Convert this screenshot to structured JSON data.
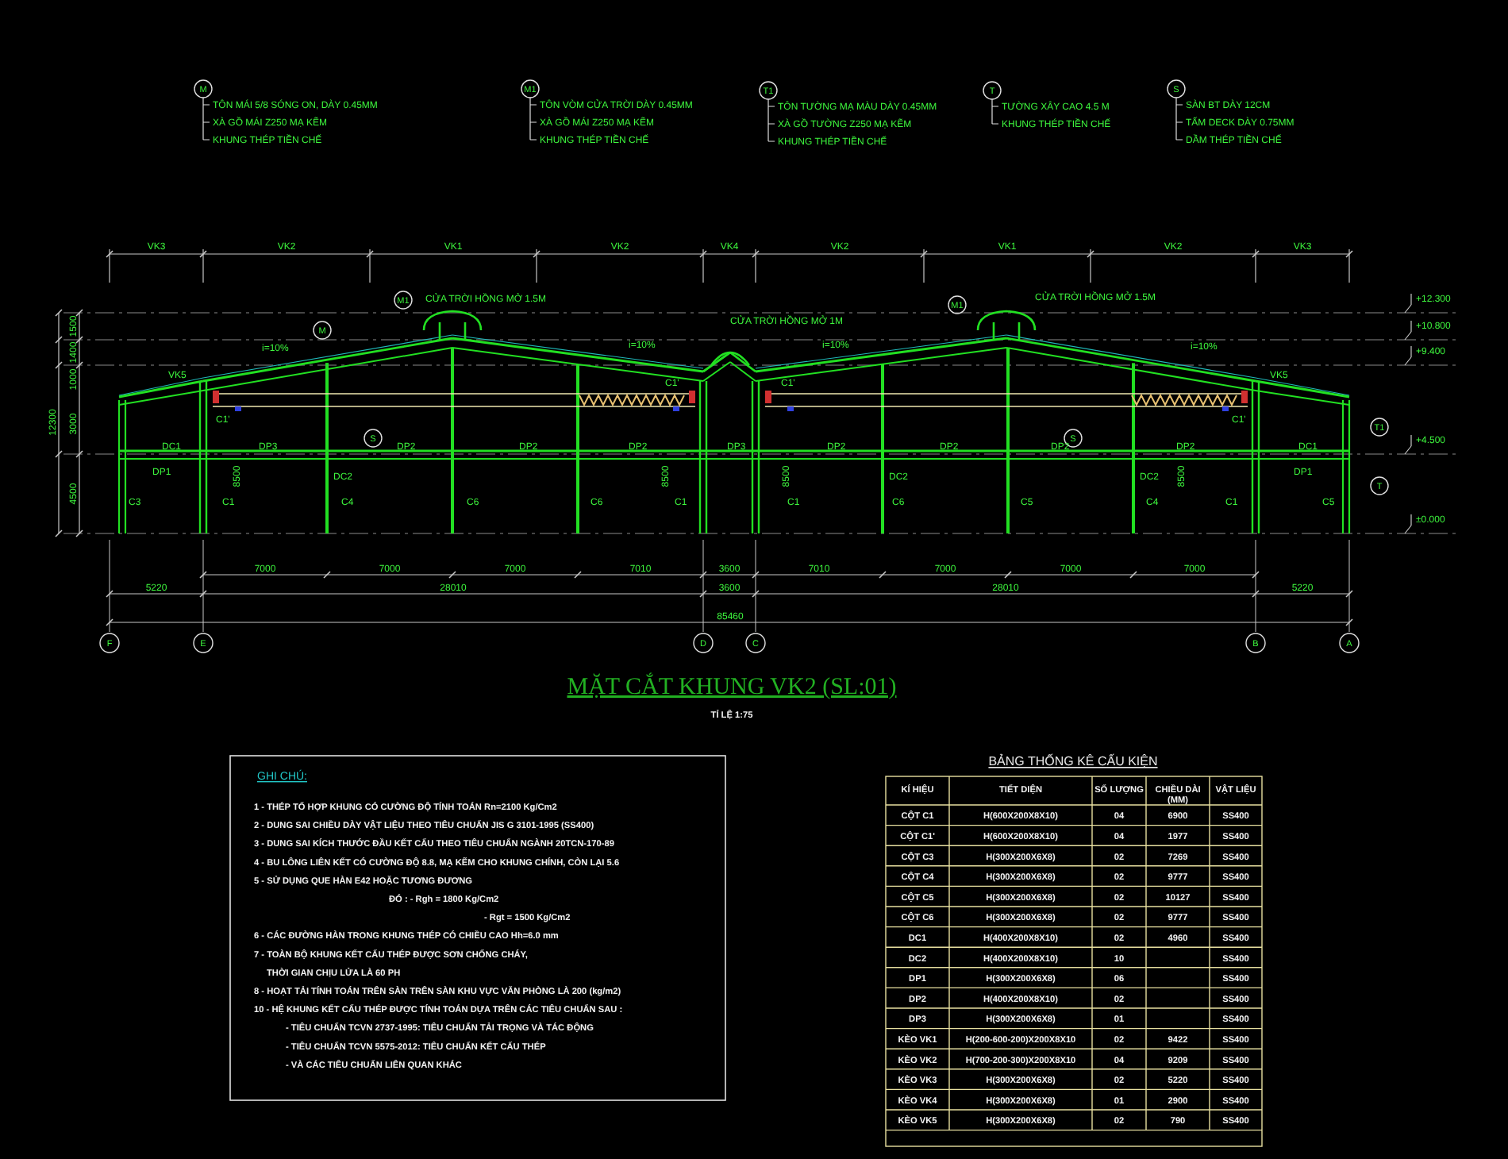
{
  "legend": [
    {
      "marker": "M",
      "lines": [
        "TÔN MÁI 5/8 SÓNG ON, DÀY 0.45MM",
        "XÀ GỒ MÁI Z250 MẠ KẼM",
        "KHUNG THÉP TIỀN CHẾ"
      ]
    },
    {
      "marker": "M1",
      "lines": [
        "TÔN VÒM CỬA TRỜI DÀY 0.45MM",
        "XÀ GỒ MÁI Z250 MẠ KẼM",
        "KHUNG THÉP TIỀN CHẾ"
      ]
    },
    {
      "marker": "T1",
      "lines": [
        "TÔN TƯỜNG MẠ MÀU DÀY 0.45MM",
        "XÀ GỒ TƯỜNG Z250 MẠ KẼM",
        "KHUNG THÉP TIỀN CHẾ"
      ]
    },
    {
      "marker": "T",
      "lines": [
        "TƯỜNG XÂY CAO 4.5 M",
        "KHUNG THÉP TIỀN CHẾ"
      ]
    },
    {
      "marker": "S",
      "lines": [
        "SÀN BT DÀY 12CM",
        "TẤM DECK DÀY 0.75MM",
        "DẦM THÉP TIỀN CHẾ"
      ]
    }
  ],
  "section": {
    "span_labels": [
      "VK3",
      "VK2",
      "VK1",
      "VK2",
      "VK4",
      "VK2",
      "VK1",
      "VK2",
      "VK3"
    ],
    "elevations": [
      "+12.300",
      "+10.800",
      "+9.400",
      "+4.500",
      "±0.000"
    ],
    "height_dims": [
      "1500",
      "1400",
      "1000",
      "3000",
      "4500",
      "12300"
    ],
    "dims_row1": [
      "7000",
      "7000",
      "7000",
      "7010",
      "3600",
      "7010",
      "7000",
      "7000",
      "7000"
    ],
    "dims_row2": [
      "5220",
      "28010",
      "3600",
      "28010",
      "5220"
    ],
    "overall_dim": "85460",
    "axes": [
      "F",
      "E",
      "D",
      "C",
      "B",
      "A"
    ],
    "callouts": [
      "CỬA TRỜI HỒNG MỞ 1.5M",
      "CỬA TRỜI HỒNG MỞ 1M",
      "CỬA TRỜI HỒNG MỞ 1.5M"
    ],
    "markers": [
      "M1",
      "M",
      "S",
      "M1",
      "S",
      "T1",
      "T"
    ],
    "slopes": [
      "i=10%",
      "i=10%",
      "i=10%",
      "i=10%"
    ],
    "member_labels": [
      "VK5",
      "C1'",
      "C1'",
      "C1'",
      "C1'",
      "VK5",
      "DC1",
      "DP3",
      "DP2",
      "DP2",
      "DP2",
      "DP3",
      "DP2",
      "DP2",
      "DP2",
      "DP2",
      "DC1",
      "DP1",
      "DC2",
      "DC2",
      "DC2",
      "DP1",
      "C3",
      "C1",
      "C4",
      "C6",
      "C6",
      "C1",
      "C1",
      "C6",
      "C5",
      "C4",
      "C1",
      "C5",
      "8500",
      "8500",
      "8500",
      "8500"
    ]
  },
  "title": "MẶT CẮT KHUNG VK2 (SL:01)",
  "scale": "TỈ LỆ 1:75",
  "notes": {
    "heading": "GHI CHÚ:",
    "lines": [
      {
        "kind": "item",
        "text": "1 - THÉP TỔ HỢP KHUNG CÓ CƯỜNG ĐỘ TÍNH TOÁN Rn=2100 Kg/Cm2"
      },
      {
        "kind": "item",
        "text": "2 - DUNG SAI CHIỀU DÀY VẬT LIỆU THEO TIÊU CHUẨN JIS G 3101-1995 (SS400)"
      },
      {
        "kind": "item",
        "text": "3 - DUNG SAI KÍCH THƯỚC ĐẦU KẾT CẤU THEO TIÊU CHUẨN NGÀNH 20TCN-170-89"
      },
      {
        "kind": "item",
        "text": "4 - BU LÔNG LIÊN KẾT CÓ CƯỜNG ĐỘ 8.8, MẠ KẼM CHO KHUNG CHÍNH, CÒN LẠI 5.6"
      },
      {
        "kind": "item",
        "text": "5 - SỬ DỤNG QUE HÀN E42 HOẶC TƯƠNG ĐƯƠNG"
      },
      {
        "kind": "formula",
        "text": "ĐÓ : - Rgh = 1800 Kg/Cm2"
      },
      {
        "kind": "formula2",
        "text": "- Rgt = 1500 Kg/Cm2"
      },
      {
        "kind": "item",
        "text": "6 - CÁC ĐƯỜNG HÀN TRONG KHUNG THÉP CÓ CHIỀU CAO Hh=6.0 mm"
      },
      {
        "kind": "item",
        "text": "7 - TOÀN BỘ KHUNG KẾT CẤU THÉP ĐƯỢC SƠN CHỐNG CHÁY,"
      },
      {
        "kind": "continuation",
        "text": "THỜI GIAN CHỊU LỬA LÀ 60 PH"
      },
      {
        "kind": "item",
        "text": "8 - HOẠT TẢI TÍNH TOÁN TRÊN SÀN TRÊN SÀN KHU VỰC VĂN PHÒNG LÀ 200 (kg/m2)"
      },
      {
        "kind": "item",
        "text": "10 - HỆ KHUNG KẾT CẤU THÉP ĐƯỢC TÍNH TOÁN DỰA TRÊN CÁC TIÊU CHUẨN SAU :"
      },
      {
        "kind": "bullet",
        "text": "- TIÊU CHUẨN TCVN 2737-1995: TIÊU CHUẨN TẢI TRỌNG VÀ TÁC ĐỘNG"
      },
      {
        "kind": "bullet",
        "text": "- TIÊU CHUẨN TCVN 5575-2012: TIÊU CHUẨN KẾT CẤU THÉP"
      },
      {
        "kind": "bullet",
        "text": "- VÀ CÁC TIÊU CHUẨN LIÊN QUAN KHÁC"
      }
    ]
  },
  "table": {
    "title": "BẢNG THỐNG KÊ CẤU KIỆN",
    "columns": [
      "KÍ HIỆU",
      "TIẾT DIỆN",
      "SỐ LƯỢNG",
      "CHIỀU DÀI",
      "VẬT LIỆU"
    ],
    "length_unit": "(MM)",
    "rows": [
      {
        "symbol": "CỘT C1",
        "section": "H(600X200X8X10)",
        "qty": "04",
        "length": "6900",
        "material": "SS400"
      },
      {
        "symbol": "CỘT C1'",
        "section": "H(600X200X8X10)",
        "qty": "04",
        "length": "1977",
        "material": "SS400"
      },
      {
        "symbol": "CỘT C3",
        "section": "H(300X200X6X8)",
        "qty": "02",
        "length": "7269",
        "material": "SS400"
      },
      {
        "symbol": "CỘT C4",
        "section": "H(300X200X6X8)",
        "qty": "02",
        "length": "9777",
        "material": "SS400"
      },
      {
        "symbol": "CỘT C5",
        "section": "H(300X200X6X8)",
        "qty": "02",
        "length": "10127",
        "material": "SS400"
      },
      {
        "symbol": "CỘT C6",
        "section": "H(300X200X6X8)",
        "qty": "02",
        "length": "9777",
        "material": "SS400"
      },
      {
        "symbol": "DC1",
        "section": "H(400X200X8X10)",
        "qty": "02",
        "length": "4960",
        "material": "SS400"
      },
      {
        "symbol": "DC2",
        "section": "H(400X200X8X10)",
        "qty": "10",
        "material": "SS400"
      },
      {
        "symbol": "DP1",
        "section": "H(300X200X6X8)",
        "qty": "06",
        "material": "SS400"
      },
      {
        "symbol": "DP2",
        "section": "H(400X200X8X10)",
        "qty": "02",
        "material": "SS400"
      },
      {
        "symbol": "DP3",
        "section": "H(300X200X6X8)",
        "qty": "01",
        "material": "SS400"
      },
      {
        "symbol": "KÈO VK1",
        "section": "H(200-600-200)X200X8X10",
        "qty": "02",
        "length": "9422",
        "material": "SS400"
      },
      {
        "symbol": "KÈO VK2",
        "section": "H(700-200-300)X200X8X10",
        "qty": "04",
        "length": "9209",
        "material": "SS400"
      },
      {
        "symbol": "KÈO VK3",
        "section": "H(300X200X6X8)",
        "qty": "02",
        "length": "5220",
        "material": "SS400"
      },
      {
        "symbol": "KÈO VK4",
        "section": "H(300X200X6X8)",
        "qty": "01",
        "length": "2900",
        "material": "SS400"
      },
      {
        "symbol": "KÈO VK5",
        "section": "H(300X200X6X8)",
        "qty": "02",
        "length": "790",
        "material": "SS400"
      }
    ]
  }
}
